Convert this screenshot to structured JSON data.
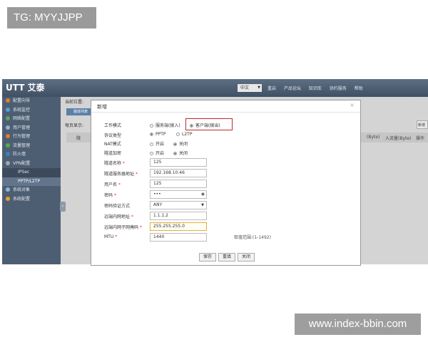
{
  "overlay": {
    "tag": "TG: MYYJJPP",
    "watermark": "www.index-bbin.com"
  },
  "app": {
    "logo": "UTT 艾泰",
    "language": "中文",
    "topnav": [
      "重启",
      "产品论坛",
      "知识库",
      "协约服务",
      "帮助"
    ],
    "sidebar": [
      {
        "label": "配置向导",
        "icon": "wizard-icon",
        "color": "#d9822b"
      },
      {
        "label": "系统监控",
        "icon": "monitor-icon",
        "color": "#4fa3d8"
      },
      {
        "label": "网络配置",
        "icon": "network-icon",
        "color": "#58a55c"
      },
      {
        "label": "用户管理",
        "icon": "users-icon",
        "color": "#8fb3d9"
      },
      {
        "label": "行为管理",
        "icon": "behavior-icon",
        "color": "#e07b39"
      },
      {
        "label": "流量管理",
        "icon": "traffic-icon",
        "color": "#4caf50"
      },
      {
        "label": "防火墙",
        "icon": "firewall-icon",
        "color": "#3f7fbf"
      },
      {
        "label": "VPN配置",
        "icon": "vpn-icon",
        "color": "#9aa8b8"
      }
    ],
    "sidebar_sub": [
      "IPSec",
      "PPTP/L2TP"
    ],
    "sidebar_bottom": [
      {
        "label": "系统对象",
        "icon": "objects-icon",
        "color": "#8fb3d9"
      },
      {
        "label": "系统配置",
        "icon": "system-icon",
        "color": "#e0a030"
      }
    ],
    "content": {
      "breadcrumb": "当前位置:",
      "tab": "隧道列表",
      "per_page": "每页显示:",
      "header_left": "隧",
      "header_cols": [
        "(Byte)",
        "入流量(Byte)",
        "操作"
      ],
      "new_button": "新增"
    }
  },
  "dialog": {
    "title": "新增",
    "close": "×",
    "rows": {
      "work_mode": {
        "label": "工作模式",
        "opt1": "服务端(拨入)",
        "opt2": "客户端(拨出)"
      },
      "protocol": {
        "label": "协议类型",
        "opt1": "PPTP",
        "opt2": "L2TP"
      },
      "nat": {
        "label": "NAT模式",
        "opt1": "开启",
        "opt2": "关闭"
      },
      "encrypt": {
        "label": "隧道加密",
        "opt1": "开启",
        "opt2": "关闭"
      },
      "tunnel_name": {
        "label": "隧道名称",
        "value": "125"
      },
      "server_addr": {
        "label": "隧道服务器地址",
        "value": "192.168.10.46"
      },
      "username": {
        "label": "用户名",
        "value": "125"
      },
      "password": {
        "label": "密码",
        "value": "•••"
      },
      "auth": {
        "label": "密码验证方式",
        "value": "ANY"
      },
      "remote_ip": {
        "label": "远端内网地址",
        "value": "1.1.1.2"
      },
      "remote_mask": {
        "label": "远端内网子网掩码",
        "value": "255.255.255.0"
      },
      "mtu": {
        "label": "MTU",
        "value": "1440",
        "hint": "取值范围:(1-1492)"
      }
    },
    "buttons": {
      "save": "保存",
      "reset": "重填",
      "close": "关闭"
    }
  }
}
